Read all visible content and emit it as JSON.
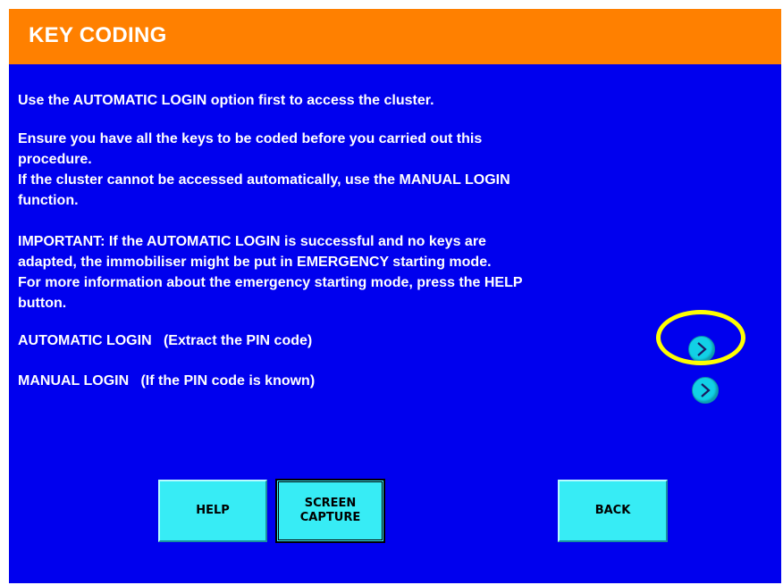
{
  "header": {
    "title": "KEY CODING"
  },
  "instructions": {
    "line1": "Use the AUTOMATIC LOGIN option first to access the cluster.",
    "para2": [
      "Ensure you have all the keys to be coded before you carried out this",
      "procedure.",
      "If the cluster cannot be accessed automatically, use the MANUAL LOGIN",
      "function."
    ],
    "para3": [
      "IMPORTANT: If the AUTOMATIC LOGIN is successful and no keys are",
      "adapted, the immobiliser might be put in EMERGENCY starting mode.",
      "For more information about the emergency starting mode, press the HELP",
      "button."
    ]
  },
  "options": [
    {
      "label": "AUTOMATIC LOGIN   (Extract the PIN code)",
      "icon": "chevron-right-icon",
      "highlighted": true
    },
    {
      "label": "MANUAL LOGIN   (If the PIN code is known)",
      "icon": "chevron-right-icon",
      "highlighted": false
    }
  ],
  "buttons": {
    "help": "HELP",
    "screen_capture": "SCREEN\nCAPTURE",
    "back": "BACK"
  },
  "colors": {
    "background": "#0000ee",
    "header": "#ff8000",
    "button": "#37ecf5",
    "arrow": "#12d0e6",
    "highlight": "#ffff00"
  }
}
